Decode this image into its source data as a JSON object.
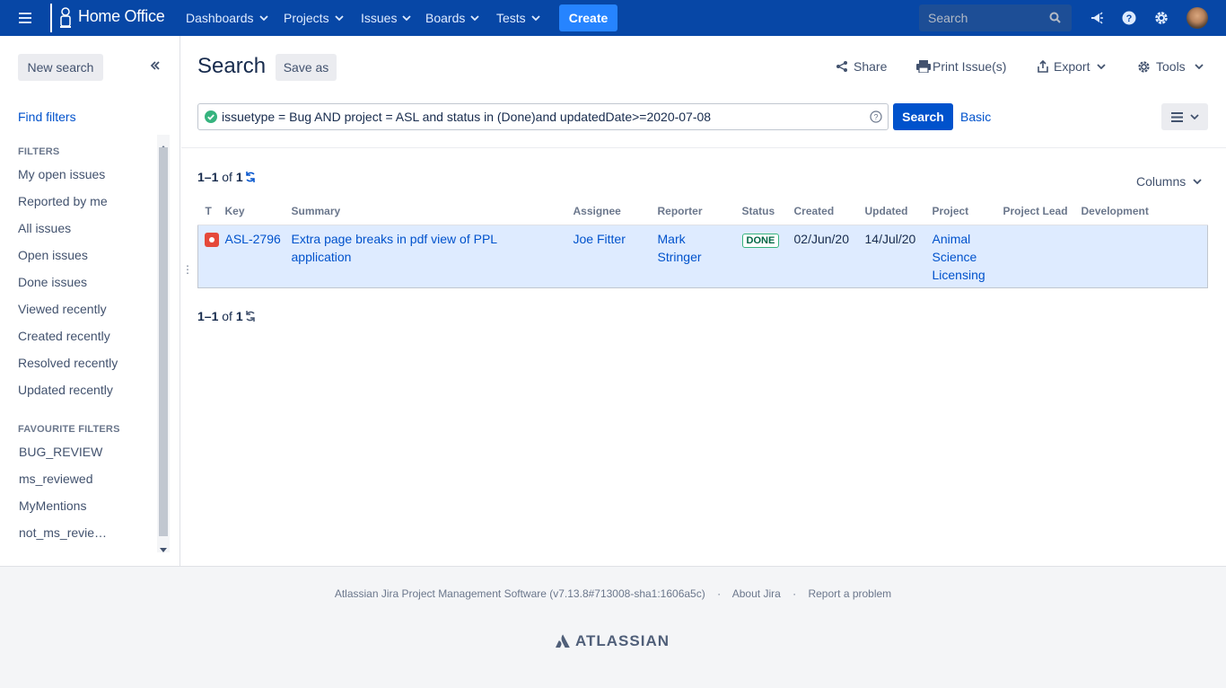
{
  "nav": {
    "logo": "Home Office",
    "menu": [
      "Dashboards",
      "Projects",
      "Issues",
      "Boards",
      "Tests"
    ],
    "create": "Create",
    "search_placeholder": "Search"
  },
  "sidebar": {
    "new_search": "New search",
    "find_filters": "Find filters",
    "filters_heading": "FILTERS",
    "filters": [
      "My open issues",
      "Reported by me",
      "All issues",
      "Open issues",
      "Done issues",
      "Viewed recently",
      "Created recently",
      "Resolved recently",
      "Updated recently"
    ],
    "favourites_heading": "FAVOURITE FILTERS",
    "favourites": [
      "BUG_REVIEW",
      "ms_reviewed",
      "MyMentions",
      "not_ms_revie…"
    ]
  },
  "main": {
    "title": "Search",
    "save_as": "Save as",
    "tools": {
      "share": "Share",
      "print": "Print Issue(s)",
      "export": "Export",
      "tools": "Tools"
    },
    "jql": "issuetype = Bug AND project = ASL and status in (Done)and updatedDate>=2020-07-08",
    "search_button": "Search",
    "basic": "Basic",
    "count_range": "1–1",
    "count_of": "of",
    "count_total": "1",
    "columns": "Columns",
    "table": {
      "headers": [
        "T",
        "Key",
        "Summary",
        "Assignee",
        "Reporter",
        "Status",
        "Created",
        "Updated",
        "Project",
        "Project Lead",
        "Development"
      ],
      "row": {
        "key": "ASL-2796",
        "summary": "Extra page breaks in pdf view of PPL application",
        "assignee": "Joe Fitter",
        "reporter": "Mark Stringer",
        "status": "DONE",
        "created": "02/Jun/20",
        "updated": "14/Jul/20",
        "project": "Animal Science Licensing",
        "project_lead": "",
        "development": ""
      }
    }
  },
  "footer": {
    "version": "Atlassian Jira Project Management Software (v7.13.8#713008-sha1:1606a5c)",
    "about": "About Jira",
    "report": "Report a problem",
    "brand": "ATLASSIAN"
  },
  "colors": {
    "nav_bg": "#0747a6",
    "primary": "#0052cc",
    "create": "#2684ff",
    "selected_row": "#deebff",
    "bug": "#e5493a"
  }
}
